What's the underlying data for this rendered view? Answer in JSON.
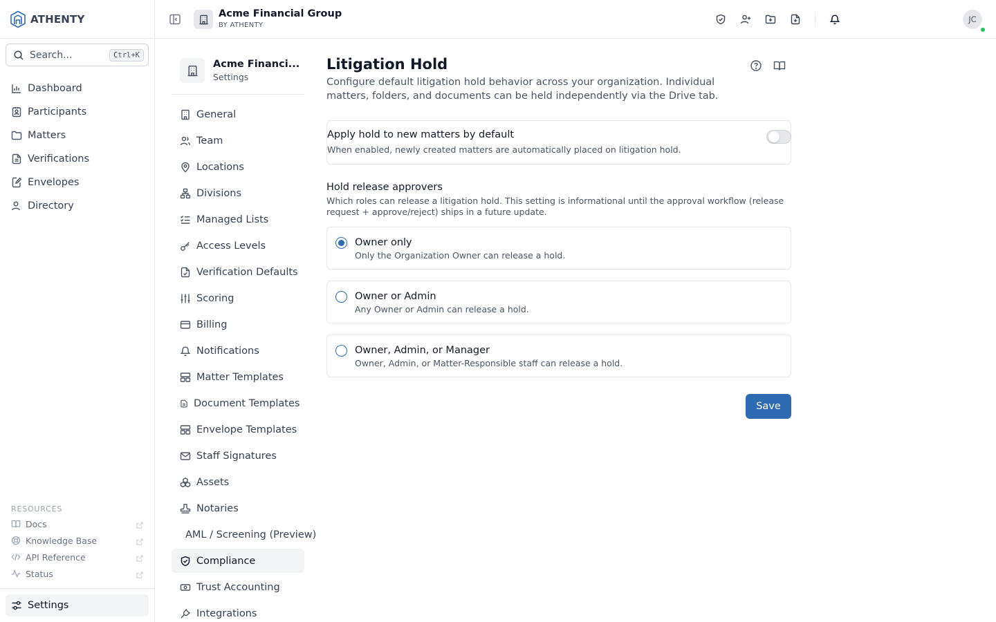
{
  "brand": {
    "name": "ATHENTY"
  },
  "search": {
    "placeholder": "Search...",
    "shortcut": "Ctrl+K"
  },
  "main_nav": [
    {
      "label": "Dashboard",
      "icon": "chart-bar-icon"
    },
    {
      "label": "Participants",
      "icon": "contact-card-icon"
    },
    {
      "label": "Matters",
      "icon": "folder-icon"
    },
    {
      "label": "Verifications",
      "icon": "file-text-icon"
    },
    {
      "label": "Envelopes",
      "icon": "file-edit-icon"
    },
    {
      "label": "Directory",
      "icon": "users-icon"
    }
  ],
  "resources": {
    "heading": "RESOURCES",
    "items": [
      {
        "label": "Docs",
        "icon": "book-icon"
      },
      {
        "label": "Knowledge Base",
        "icon": "lifebuoy-icon"
      },
      {
        "label": "API Reference",
        "icon": "code-icon"
      },
      {
        "label": "Status",
        "icon": "activity-icon"
      }
    ]
  },
  "sidebar_settings": {
    "label": "Settings"
  },
  "header": {
    "org_name": "Acme Financial Group",
    "org_sub": "BY ATHENTY",
    "avatar_initials": "JC",
    "actions": [
      "shield-check-icon",
      "user-plus-icon",
      "folder-plus-icon",
      "file-plus-icon",
      "bell-icon"
    ]
  },
  "settings_nav": {
    "org_name": "Acme Financi...",
    "subtitle": "Settings",
    "items": [
      {
        "label": "General",
        "icon": "building-icon"
      },
      {
        "label": "Team",
        "icon": "users-icon"
      },
      {
        "label": "Locations",
        "icon": "map-pin-icon"
      },
      {
        "label": "Divisions",
        "icon": "network-icon"
      },
      {
        "label": "Managed Lists",
        "icon": "list-checks-icon"
      },
      {
        "label": "Access Levels",
        "icon": "key-icon"
      },
      {
        "label": "Verification Defaults",
        "icon": "file-check-icon"
      },
      {
        "label": "Scoring",
        "icon": "sliders-icon"
      },
      {
        "label": "Billing",
        "icon": "credit-card-icon"
      },
      {
        "label": "Notifications",
        "icon": "bell-icon"
      },
      {
        "label": "Matter Templates",
        "icon": "layout-template-icon"
      },
      {
        "label": "Document Templates",
        "icon": "file-icon"
      },
      {
        "label": "Envelope Templates",
        "icon": "layout-template-icon"
      },
      {
        "label": "Staff Signatures",
        "icon": "mail-icon"
      },
      {
        "label": "Assets",
        "icon": "boxes-icon"
      },
      {
        "label": "Notaries",
        "icon": "stamp-icon"
      },
      {
        "label": "AML / Screening (Preview)",
        "icon": ""
      },
      {
        "label": "Compliance",
        "icon": "shield-check-icon",
        "active": true
      },
      {
        "label": "Trust Accounting",
        "icon": "banknote-icon"
      },
      {
        "label": "Integrations",
        "icon": "plug-icon"
      }
    ]
  },
  "page": {
    "title": "Litigation Hold",
    "description": "Configure default litigation hold behavior across your organization. Individual matters, folders, and documents can be held independently via the Drive tab.",
    "default_hold": {
      "title": "Apply hold to new matters by default",
      "description": "When enabled, newly created matters are automatically placed on litigation hold.",
      "enabled": false
    },
    "approvers": {
      "title": "Hold release approvers",
      "description": "Which roles can release a litigation hold. This setting is informational until the approval workflow (release request + approve/reject) ships in a future update.",
      "options": [
        {
          "label": "Owner only",
          "description": "Only the Organization Owner can release a hold.",
          "selected": true
        },
        {
          "label": "Owner or Admin",
          "description": "Any Owner or Admin can release a hold.",
          "selected": false
        },
        {
          "label": "Owner, Admin, or Manager",
          "description": "Owner, Admin, or Matter-Responsible staff can release a hold.",
          "selected": false
        }
      ]
    },
    "save_label": "Save"
  },
  "colors": {
    "accent": "#2f6bb3",
    "status_online": "#22c55e",
    "active_bg": "#f3f4f6"
  }
}
